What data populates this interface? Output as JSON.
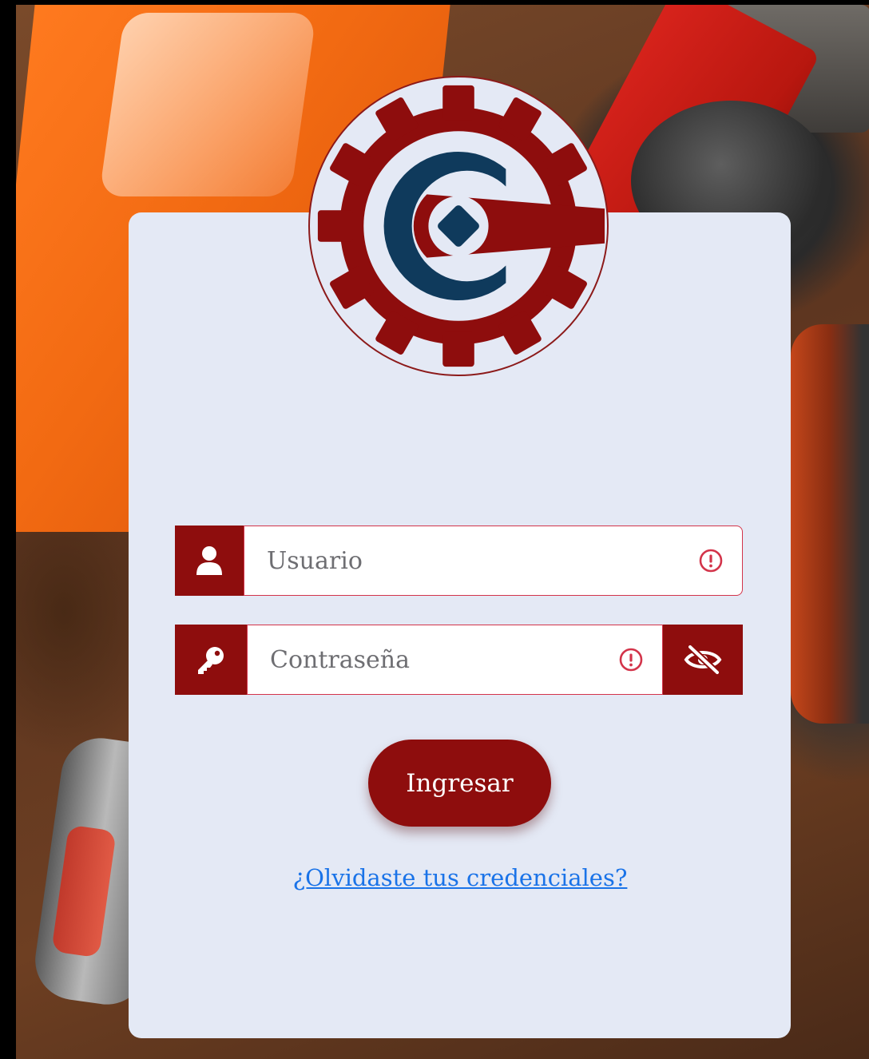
{
  "login": {
    "username_placeholder": "Usuario",
    "password_placeholder": "Contraseña",
    "submit_label": "Ingresar",
    "forgot_label": "¿Olvidaste tus credenciales?"
  },
  "icons": {
    "user": "user-icon",
    "key": "key-icon",
    "alert": "exclamation-circle-icon",
    "toggle_password": "eye-slash-icon"
  },
  "colors": {
    "primary": "#8e0d0d",
    "logo_navy": "#0f3a5c",
    "card_bg": "#e4e9f5",
    "link": "#1a73e8",
    "error_border": "#d3344a"
  }
}
